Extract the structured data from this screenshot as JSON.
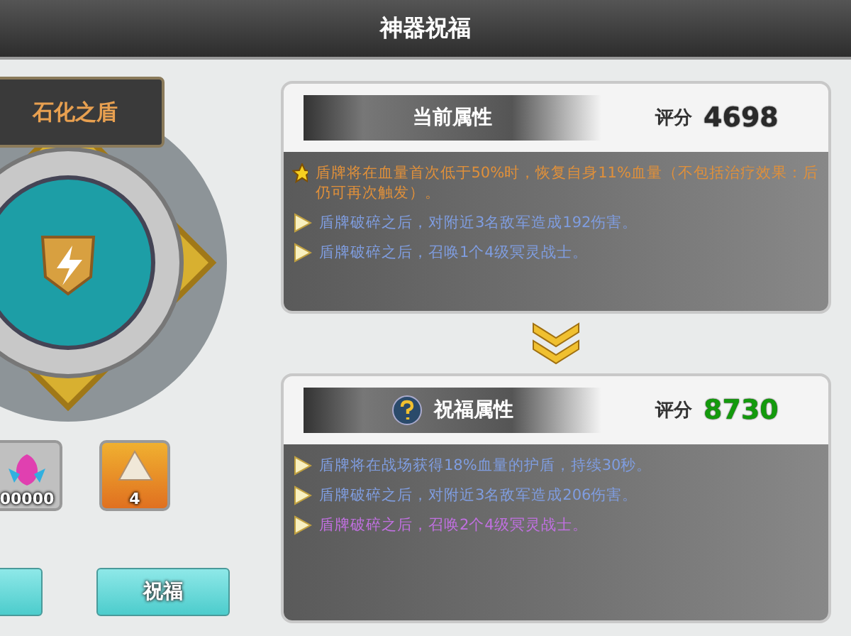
{
  "window": {
    "title": "神器祝福"
  },
  "artifact": {
    "name": "石化之盾"
  },
  "materials": [
    {
      "count": "00000"
    },
    {
      "count": "4"
    }
  ],
  "bless_button": {
    "label": "祝福"
  },
  "current": {
    "title": "当前属性",
    "score_label": "评分",
    "score": "4698",
    "effects": [
      {
        "kind": "star",
        "color": "#e0903a",
        "text": "盾牌将在血量首次低于50%时，恢复自身11%血量（不包括治疗效果：后仍可再次触发）。"
      },
      {
        "kind": "arrow",
        "color": "#7f9de0",
        "text": "盾牌破碎之后，对附近3名敌军造成192伤害。"
      },
      {
        "kind": "arrow",
        "color": "#7f9de0",
        "text": "盾牌破碎之后，召唤1个4级冥灵战士。"
      }
    ]
  },
  "blessed": {
    "title": "祝福属性",
    "score_label": "评分",
    "score": "8730",
    "effects": [
      {
        "kind": "arrow",
        "color": "#7f9de0",
        "text": "盾牌将在战场获得18%血量的护盾，持续30秒。"
      },
      {
        "kind": "arrow",
        "color": "#7f9de0",
        "text": "盾牌破碎之后，对附近3名敌军造成206伤害。"
      },
      {
        "kind": "arrow",
        "color": "#c070e0",
        "text": "盾牌破碎之后，召唤2个4级冥灵战士。"
      }
    ]
  }
}
